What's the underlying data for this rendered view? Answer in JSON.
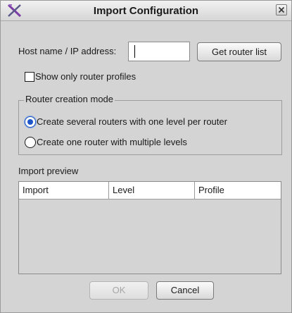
{
  "dialog": {
    "title": "Import Configuration",
    "app_icon": "x-logo-icon",
    "close_icon": "close-icon"
  },
  "host": {
    "label": "Host name / IP address:",
    "value": "",
    "get_router_list_label": "Get router list"
  },
  "filter": {
    "show_only_profiles_label": "Show only router profiles",
    "checked": false
  },
  "creation_mode": {
    "legend": "Router creation mode",
    "options": [
      {
        "label": "Create several routers with one level per router",
        "selected": true
      },
      {
        "label": "Create one router with multiple levels",
        "selected": false
      }
    ]
  },
  "preview": {
    "label": "Import preview",
    "columns": [
      "Import",
      "Level",
      "Profile"
    ],
    "rows": []
  },
  "footer": {
    "ok_label": "OK",
    "cancel_label": "Cancel"
  },
  "colors": {
    "dialog_background": "#d4d4d4",
    "radio_selected": "#1f57c8",
    "logo_accent": "#7b3fa6"
  }
}
